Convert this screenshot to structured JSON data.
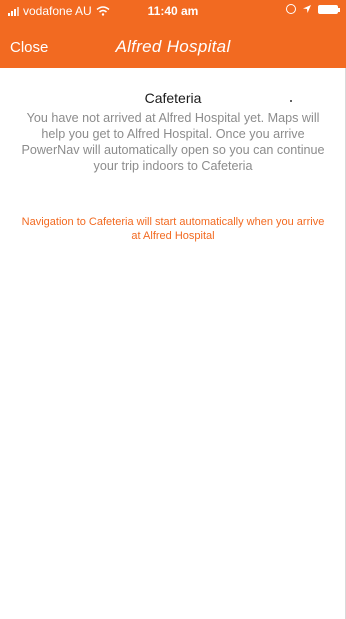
{
  "status_bar": {
    "carrier": "vodafone AU",
    "time": "11:40 am",
    "icons": [
      "signal-icon",
      "wifi-icon",
      "orientation-lock-icon",
      "location-icon",
      "battery-icon"
    ]
  },
  "nav": {
    "close_label": "Close",
    "title": "Alfred Hospital"
  },
  "content": {
    "destination": "Cafeteria",
    "info": "You have not arrived at Alfred Hospital yet. Maps will help you get to Alfred Hospital. Once you arrive PowerNav will automatically open so you can continue your trip indoors to Cafeteria",
    "auto_note": "Navigation to Cafeteria will start automatically when you arrive at Alfred Hospital"
  },
  "colors": {
    "accent": "#f26a21",
    "muted_text": "#8c8c8c",
    "title_text": "#1a1a1a"
  }
}
